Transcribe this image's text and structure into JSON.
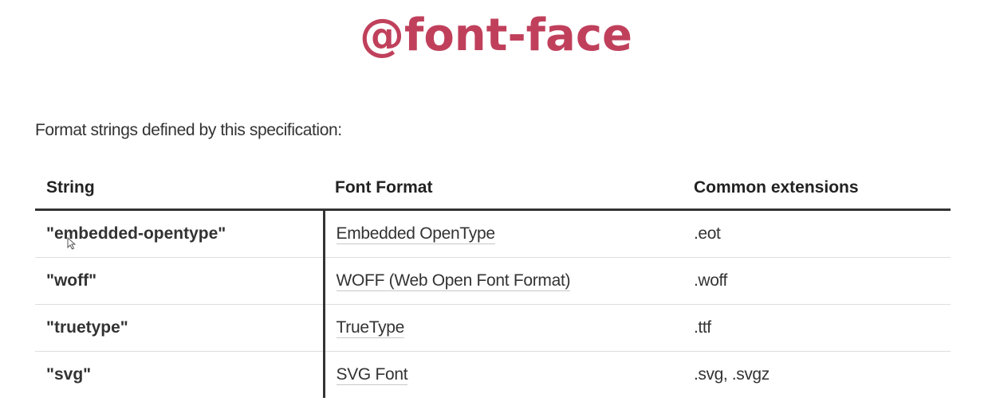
{
  "title": "@font-face",
  "intro": "Format strings defined by this specification:",
  "table": {
    "headers": [
      "String",
      "Font Format",
      "Common extensions"
    ],
    "rows": [
      {
        "string": "\"embedded-opentype\"",
        "format": "Embedded OpenType",
        "extensions": ".eot"
      },
      {
        "string": "\"woff\"",
        "format": "WOFF (Web Open Font Format)",
        "extensions": ".woff"
      },
      {
        "string": "\"truetype\"",
        "format": "TrueType",
        "extensions": ".ttf"
      },
      {
        "string": "\"svg\"",
        "format": "SVG Font",
        "extensions": ".svg, .svgz"
      }
    ]
  },
  "colors": {
    "title": "#c0405c",
    "rule": "#333333",
    "row_divider": "#dddddd"
  },
  "icons": [
    "mouse-cursor-icon"
  ]
}
